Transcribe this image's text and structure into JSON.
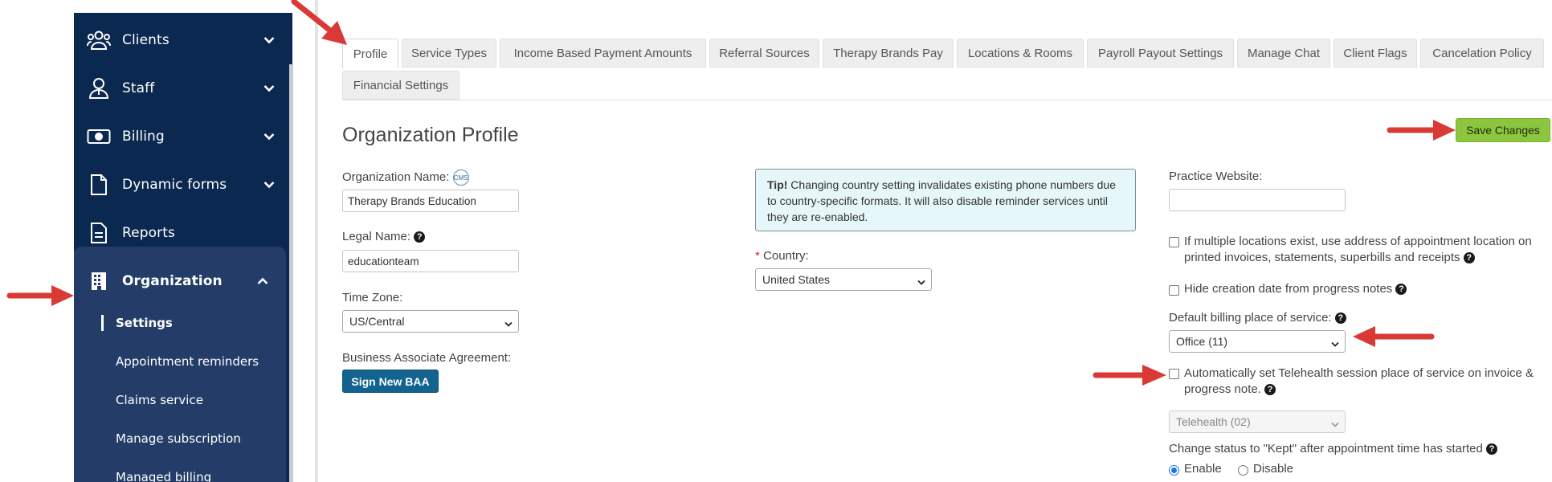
{
  "sidebar": {
    "items": [
      {
        "label": "Clients",
        "icon": "clients-icon"
      },
      {
        "label": "Staff",
        "icon": "staff-icon"
      },
      {
        "label": "Billing",
        "icon": "billing-icon"
      },
      {
        "label": "Dynamic forms",
        "icon": "document-icon"
      },
      {
        "label": "Reports",
        "icon": "reports-icon"
      },
      {
        "label": "Organization",
        "icon": "building-icon"
      }
    ],
    "organization_subitems": [
      {
        "label": "Settings",
        "active": true
      },
      {
        "label": "Appointment reminders"
      },
      {
        "label": "Claims service"
      },
      {
        "label": "Manage subscription"
      },
      {
        "label": "Managed billing"
      }
    ]
  },
  "tabs": [
    {
      "label": "Profile",
      "active": true
    },
    {
      "label": "Service Types"
    },
    {
      "label": "Income Based Payment Amounts"
    },
    {
      "label": "Referral Sources"
    },
    {
      "label": "Therapy Brands Pay"
    },
    {
      "label": "Locations & Rooms"
    },
    {
      "label": "Payroll Payout Settings"
    },
    {
      "label": "Manage Chat"
    },
    {
      "label": "Client Flags"
    },
    {
      "label": "Cancelation Policy"
    },
    {
      "label": "Financial Settings"
    }
  ],
  "page": {
    "title": "Organization Profile",
    "save_label": "Save Changes"
  },
  "form": {
    "org_name_label": "Organization Name:",
    "cms_badge": "CMS",
    "org_name_value": "Therapy Brands Education",
    "legal_name_label": "Legal Name:",
    "legal_name_value": "educationteam",
    "time_zone_label": "Time Zone:",
    "time_zone_value": "US/Central",
    "baa_label": "Business Associate Agreement:",
    "baa_button": "Sign New BAA",
    "tip_bold": "Tip!",
    "tip_text": " Changing country setting invalidates existing phone numbers due to country-specific formats. It will also disable reminder services until they are re-enabled.",
    "country_required": "*",
    "country_label": "Country:",
    "country_value": "United States",
    "website_label": "Practice Website:",
    "website_value": "",
    "multi_location_label": "If multiple locations exist, use address of appointment location on printed invoices, statements, superbills and receipts",
    "hide_date_label": "Hide creation date from progress notes",
    "billing_pos_label": "Default billing place of service:",
    "billing_pos_value": "Office (11)",
    "telehealth_label": "Automatically set Telehealth session place of service on invoice & progress note.",
    "telehealth_value": "Telehealth (02)",
    "kept_label": "Change status to \"Kept\" after appointment time has started",
    "enable_label": "Enable",
    "disable_label": "Disable",
    "kept_selected": "Enable"
  },
  "colors": {
    "sidebar_bg": "#0b2850",
    "sidebar_group_bg": "#233d68",
    "save_green": "#8cc63f",
    "baa_blue": "#12638f",
    "annotation_red": "#d93a36",
    "tip_bg": "#e6f7f9"
  }
}
